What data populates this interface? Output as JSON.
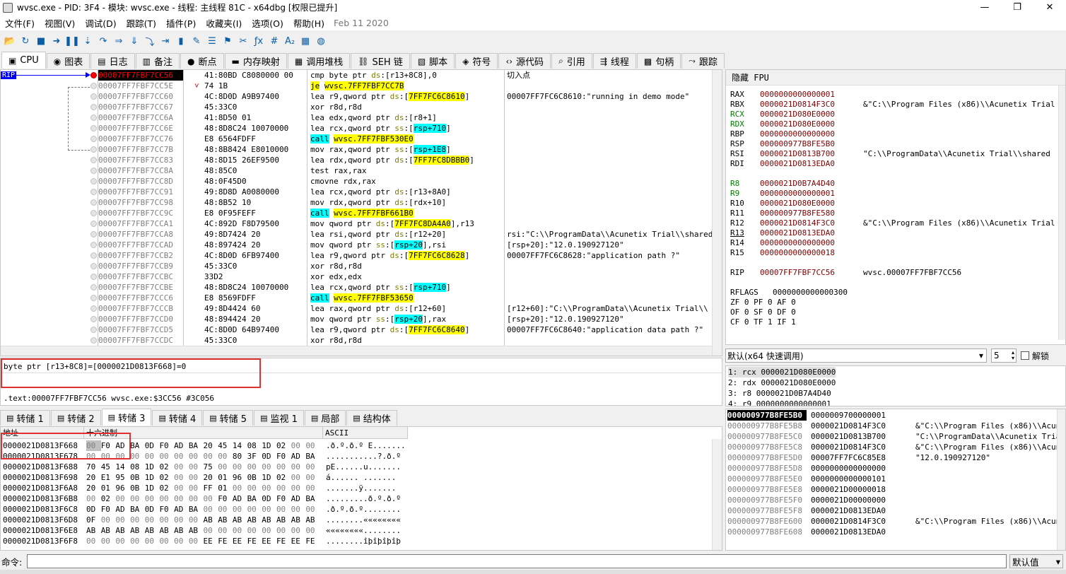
{
  "window": {
    "title": "wvsc.exe - PID: 3F4 - 模块: wvsc.exe - 线程: 主线程 81C - x64dbg [权限已提升]",
    "min_glyph": "—",
    "max_glyph": "❐",
    "close_glyph": "✕"
  },
  "menu": {
    "items": [
      "文件(F)",
      "视图(V)",
      "调试(D)",
      "跟踪(T)",
      "插件(P)",
      "收藏夹(I)",
      "选项(O)",
      "帮助(H)"
    ],
    "date": "Feb 11 2020"
  },
  "toolbar_icons": [
    {
      "name": "open-icon",
      "glyph": "📂"
    },
    {
      "name": "restart-icon",
      "glyph": "↻"
    },
    {
      "name": "stop-icon",
      "glyph": "■"
    },
    {
      "name": "run-icon",
      "glyph": "➜"
    },
    {
      "name": "pause-icon",
      "glyph": "❚❚"
    },
    {
      "name": "step-into-icon",
      "glyph": "⇣"
    },
    {
      "name": "step-over-icon",
      "glyph": "↷"
    },
    {
      "name": "trace-into-icon",
      "glyph": "⇒"
    },
    {
      "name": "trace-over-icon",
      "glyph": "⇓"
    },
    {
      "name": "execute-till-return-icon",
      "glyph": "⤵"
    },
    {
      "name": "run-to-user-code-icon",
      "glyph": "⇥"
    },
    {
      "name": "scylla-icon",
      "glyph": "▮"
    },
    {
      "name": "patch-icon",
      "glyph": "✎"
    },
    {
      "name": "comment-icon",
      "glyph": "☰"
    },
    {
      "name": "label-icon",
      "glyph": "⚑"
    },
    {
      "name": "bookmark-icon",
      "glyph": "✂"
    },
    {
      "name": "function-icon",
      "glyph": "ƒx"
    },
    {
      "name": "hash-icon",
      "glyph": "#"
    },
    {
      "name": "strings-icon",
      "glyph": "A₂"
    },
    {
      "name": "calculator-icon",
      "glyph": "▦"
    },
    {
      "name": "globe-icon",
      "glyph": "◍"
    }
  ],
  "tabs": [
    {
      "label": "CPU",
      "icon": "cpu-icon",
      "glyph": "▣"
    },
    {
      "label": "图表",
      "icon": "graph-icon",
      "glyph": "◉"
    },
    {
      "label": "日志",
      "icon": "log-icon",
      "glyph": "▤"
    },
    {
      "label": "备注",
      "icon": "notes-icon",
      "glyph": "▥"
    },
    {
      "label": "断点",
      "icon": "breakpoint-icon",
      "glyph": "●"
    },
    {
      "label": "内存映射",
      "icon": "memory-map-icon",
      "glyph": "▬"
    },
    {
      "label": "调用堆栈",
      "icon": "call-stack-icon",
      "glyph": "▦"
    },
    {
      "label": "SEH 链",
      "icon": "seh-icon",
      "glyph": "⛓"
    },
    {
      "label": "脚本",
      "icon": "script-icon",
      "glyph": "▧"
    },
    {
      "label": "符号",
      "icon": "symbols-icon",
      "glyph": "◈"
    },
    {
      "label": "源代码",
      "icon": "source-icon",
      "glyph": "‹›"
    },
    {
      "label": "引用",
      "icon": "references-icon",
      "glyph": "⌕"
    },
    {
      "label": "线程",
      "icon": "threads-icon",
      "glyph": "⇶"
    },
    {
      "label": "句柄",
      "icon": "handles-icon",
      "glyph": "▩"
    },
    {
      "label": "跟踪",
      "icon": "trace-icon",
      "glyph": "⤳"
    }
  ],
  "disasm": {
    "rip_label": "RIP",
    "header_comment": "切入点",
    "rows": [
      {
        "addr": "00007FF7FBF7CC56",
        "bytes": "41:80BD C8080000 00",
        "ins": [
          "cmp byte ptr ",
          [
            "ds",
            "seg"
          ],
          ":[r13+8C8],0"
        ],
        "cmt": "",
        "cur": true
      },
      {
        "addr": "00007FF7FBF7CC5E",
        "bytes": "74 1B",
        "ins": [
          [
            "je",
            "je"
          ],
          " ",
          [
            "wvsc.7FF7FBF7CC7B",
            "tgt"
          ]
        ],
        "cmt": "",
        "mark": "˅"
      },
      {
        "addr": "00007FF7FBF7CC60",
        "bytes": "4C:8D0D A9B97400",
        "ins": [
          "lea r9,qword ptr ",
          [
            "ds",
            "seg"
          ],
          ":[",
          [
            "7FF7FC6C8610",
            "mem"
          ],
          "]"
        ],
        "cmt": "00007FF7FC6C8610:\"running in demo mode\""
      },
      {
        "addr": "00007FF7FBF7CC67",
        "bytes": "45:33C0",
        "ins": [
          "xor r8d,r8d"
        ],
        "cmt": ""
      },
      {
        "addr": "00007FF7FBF7CC6A",
        "bytes": "41:8D50 01",
        "ins": [
          "lea edx,qword ptr ",
          [
            "ds",
            "seg"
          ],
          ":[r8+1]"
        ],
        "cmt": ""
      },
      {
        "addr": "00007FF7FBF7CC6E",
        "bytes": "48:8D8C24 10070000",
        "ins": [
          "lea rcx,qword ptr ",
          [
            "ss",
            "seg"
          ],
          ":[",
          [
            "rsp+710",
            "call"
          ],
          "]"
        ],
        "cmt": ""
      },
      {
        "addr": "00007FF7FBF7CC76",
        "bytes": "E8 6564FDFF",
        "ins": [
          [
            "call",
            "call"
          ],
          " ",
          [
            "wvsc.7FF7FBF530E0",
            "tgt"
          ]
        ],
        "cmt": ""
      },
      {
        "addr": "00007FF7FBF7CC7B",
        "bytes": "48:8B8424 E8010000",
        "ins": [
          "mov rax,qword ptr ",
          [
            "ss",
            "seg"
          ],
          ":[",
          [
            "rsp+1E8",
            "call"
          ],
          "]"
        ],
        "cmt": ""
      },
      {
        "addr": "00007FF7FBF7CC83",
        "bytes": "48:8D15 26EF9500",
        "ins": [
          "lea rdx,qword ptr ",
          [
            "ds",
            "seg"
          ],
          ":[",
          [
            "7FF7FC8DBBB0",
            "mem"
          ],
          "]"
        ],
        "cmt": ""
      },
      {
        "addr": "00007FF7FBF7CC8A",
        "bytes": "48:85C0",
        "ins": [
          "test rax,rax"
        ],
        "cmt": ""
      },
      {
        "addr": "00007FF7FBF7CC8D",
        "bytes": "48:0F45D0",
        "ins": [
          "cmovne rdx,rax"
        ],
        "cmt": ""
      },
      {
        "addr": "00007FF7FBF7CC91",
        "bytes": "49:8D8D A0080000",
        "ins": [
          "lea rcx,qword ptr ",
          [
            "ds",
            "seg"
          ],
          ":[r13+8A0]"
        ],
        "cmt": ""
      },
      {
        "addr": "00007FF7FBF7CC98",
        "bytes": "48:8B52 10",
        "ins": [
          "mov rdx,qword ptr ",
          [
            "ds",
            "seg"
          ],
          ":[rdx+10]"
        ],
        "cmt": ""
      },
      {
        "addr": "00007FF7FBF7CC9C",
        "bytes": "E8 0F95FEFF",
        "ins": [
          [
            "call",
            "call"
          ],
          " ",
          [
            "wvsc.7FF7FBF661B0",
            "tgt"
          ]
        ],
        "cmt": ""
      },
      {
        "addr": "00007FF7FBF7CCA1",
        "bytes": "4C:892D F8D79500",
        "ins": [
          "mov qword ptr ",
          [
            "ds",
            "seg"
          ],
          ":[",
          [
            "7FF7FC8DA4A0",
            "mem"
          ],
          "],r13"
        ],
        "cmt": ""
      },
      {
        "addr": "00007FF7FBF7CCA8",
        "bytes": "49:8D7424 20",
        "ins": [
          "lea rsi,qword ptr ",
          [
            "ds",
            "seg"
          ],
          ":[r12+20]"
        ],
        "cmt": "rsi:\"C:\\\\ProgramData\\\\Acunetix Trial\\\\shared\""
      },
      {
        "addr": "00007FF7FBF7CCAD",
        "bytes": "48:897424 20",
        "ins": [
          "mov qword ptr ",
          [
            "ss",
            "seg"
          ],
          ":[",
          [
            "rsp+20",
            "call"
          ],
          "],rsi"
        ],
        "cmt": "[rsp+20]:\"12.0.190927120\""
      },
      {
        "addr": "00007FF7FBF7CCB2",
        "bytes": "4C:8D0D 6FB97400",
        "ins": [
          "lea r9,qword ptr ",
          [
            "ds",
            "seg"
          ],
          ":[",
          [
            "7FF7FC6C8628",
            "mem"
          ],
          "]"
        ],
        "cmt": "00007FF7FC6C8628:\"application path ?\""
      },
      {
        "addr": "00007FF7FBF7CCB9",
        "bytes": "45:33C0",
        "ins": [
          "xor r8d,r8d"
        ],
        "cmt": ""
      },
      {
        "addr": "00007FF7FBF7CCBC",
        "bytes": "33D2",
        "ins": [
          "xor edx,edx"
        ],
        "cmt": ""
      },
      {
        "addr": "00007FF7FBF7CCBE",
        "bytes": "48:8D8C24 10070000",
        "ins": [
          "lea rcx,qword ptr ",
          [
            "ss",
            "seg"
          ],
          ":[",
          [
            "rsp+710",
            "call"
          ],
          "]"
        ],
        "cmt": ""
      },
      {
        "addr": "00007FF7FBF7CCC6",
        "bytes": "E8 8569FDFF",
        "ins": [
          [
            "call",
            "call"
          ],
          " ",
          [
            "wvsc.7FF7FBF53650",
            "tgt"
          ]
        ],
        "cmt": ""
      },
      {
        "addr": "00007FF7FBF7CCCB",
        "bytes": "49:8D4424 60",
        "ins": [
          "lea rax,qword ptr ",
          [
            "ds",
            "seg"
          ],
          ":[r12+60]"
        ],
        "cmt": "[r12+60]:\"C:\\\\ProgramData\\\\Acunetix Trial\\\\"
      },
      {
        "addr": "00007FF7FBF7CCD0",
        "bytes": "48:894424 20",
        "ins": [
          "mov qword ptr ",
          [
            "ss",
            "seg"
          ],
          ":[",
          [
            "rsp+20",
            "call"
          ],
          "],rax"
        ],
        "cmt": "[rsp+20]:\"12.0.190927120\""
      },
      {
        "addr": "00007FF7FBF7CCD5",
        "bytes": "4C:8D0D 64B97400",
        "ins": [
          "lea r9,qword ptr ",
          [
            "ds",
            "seg"
          ],
          ":[",
          [
            "7FF7FC6C8640",
            "mem"
          ],
          "]"
        ],
        "cmt": "00007FF7FC6C8640:\"application data path ?\""
      },
      {
        "addr": "00007FF7FBF7CCDC",
        "bytes": "45:33C0",
        "ins": [
          "xor r8d,r8d"
        ],
        "cmt": ""
      }
    ]
  },
  "info": {
    "line1": "byte ptr [r13+8C8]=[0000021D0813F668]=0",
    "line2": ".text:00007FF7FBF7CC56 wvsc.exe:$3CC56 #3C056"
  },
  "regs": {
    "tabs": [
      "隐藏 FPU"
    ],
    "rows": [
      {
        "n": "RAX",
        "v": "0000000000000001",
        "c": ""
      },
      {
        "n": "RBX",
        "v": "0000021D0814F3C0",
        "c": "&\"C:\\\\Program Files (x86)\\\\Acunetix Trial"
      },
      {
        "n": "RCX",
        "v": "0000021D080E0000",
        "c": "",
        "chg": true
      },
      {
        "n": "RDX",
        "v": "0000021D080E0000",
        "c": "",
        "chg": true
      },
      {
        "n": "RBP",
        "v": "0000000000000000",
        "c": ""
      },
      {
        "n": "RSP",
        "v": "000000977B8FE5B0",
        "c": ""
      },
      {
        "n": "RSI",
        "v": "0000021D0813B700",
        "c": "\"C:\\\\ProgramData\\\\Acunetix Trial\\\\shared"
      },
      {
        "n": "RDI",
        "v": "0000021D0813EDA0",
        "c": ""
      },
      {
        "n": "",
        "v": "",
        "c": ""
      },
      {
        "n": "R8",
        "v": "0000021D0B7A4D40",
        "c": "",
        "chg": true
      },
      {
        "n": "R9",
        "v": "0000000000000001",
        "c": "",
        "chg": true
      },
      {
        "n": "R10",
        "v": "0000021D080E0000",
        "c": ""
      },
      {
        "n": "R11",
        "v": "000000977B8FE580",
        "c": ""
      },
      {
        "n": "R12",
        "v": "0000021D0814F3C0",
        "c": "&\"C:\\\\Program Files (x86)\\\\Acunetix Trial"
      },
      {
        "n": "R13",
        "v": "0000021D0813EDA0",
        "c": "",
        "ul": true
      },
      {
        "n": "R14",
        "v": "0000000000000000",
        "c": ""
      },
      {
        "n": "R15",
        "v": "0000000000000018",
        "c": ""
      },
      {
        "n": "",
        "v": "",
        "c": ""
      },
      {
        "n": "RIP",
        "v": "00007FF7FBF7CC56",
        "c": "wvsc.00007FF7FBF7CC56"
      },
      {
        "n": "",
        "v": "",
        "c": ""
      },
      {
        "n": "RFLAGS",
        "v": "0000000000000300",
        "c": "",
        "plain": true
      }
    ],
    "flags": [
      "ZF 0   PF 0   AF 0",
      "OF 0   SF 0   DF 0",
      "CF 0   TF 1   IF 1"
    ]
  },
  "callconv": {
    "selected": "默认(x64 快速调用)",
    "count": "5",
    "unlock_label": "解锁"
  },
  "args": [
    "1: rcx 0000021D080E0000",
    "2: rdx 0000021D080E0000",
    "3: r8 0000021D0B7A4D40",
    "4: r9 0000000000000001"
  ],
  "dump_tabs": [
    {
      "label": "转储 1",
      "icon": "dump-icon"
    },
    {
      "label": "转储 2",
      "icon": "dump-icon"
    },
    {
      "label": "转储 3",
      "icon": "dump-icon",
      "active": true
    },
    {
      "label": "转储 4",
      "icon": "dump-icon"
    },
    {
      "label": "转储 5",
      "icon": "dump-icon"
    },
    {
      "label": "监视 1",
      "icon": "watch-icon"
    },
    {
      "label": "局部",
      "icon": "locals-icon"
    },
    {
      "label": "结构体",
      "icon": "struct-icon"
    }
  ],
  "dump": {
    "headers": {
      "addr": "地址",
      "hex": "十六进制",
      "ascii": "ASCII"
    },
    "rows": [
      {
        "a": "0000021D0813F668",
        "h": [
          "00",
          "F0",
          "AD",
          "BA",
          "0D",
          "F0",
          "AD",
          "BA",
          "20",
          "45",
          "14",
          "08",
          "1D",
          "02",
          "00",
          "00"
        ],
        "s": ".ð.º.ð.º E......."
      },
      {
        "a": "0000021D0813F678",
        "h": [
          "00",
          "00",
          "00",
          "00",
          "00",
          "00",
          "00",
          "00",
          "00",
          "00",
          "80",
          "3F",
          "0D",
          "F0",
          "AD",
          "BA"
        ],
        "s": "...........?.ð.º"
      },
      {
        "a": "0000021D0813F688",
        "h": [
          "70",
          "45",
          "14",
          "08",
          "1D",
          "02",
          "00",
          "00",
          "75",
          "00",
          "00",
          "00",
          "00",
          "00",
          "00",
          "00"
        ],
        "s": "pE......u......."
      },
      {
        "a": "0000021D0813F698",
        "h": [
          "20",
          "E1",
          "95",
          "0B",
          "1D",
          "02",
          "00",
          "00",
          "20",
          "01",
          "96",
          "0B",
          "1D",
          "02",
          "00",
          "00"
        ],
        "s": " á...... ......."
      },
      {
        "a": "0000021D0813F6A8",
        "h": [
          "20",
          "01",
          "96",
          "0B",
          "1D",
          "02",
          "00",
          "00",
          "FF",
          "01",
          "00",
          "00",
          "00",
          "00",
          "00",
          "00"
        ],
        "s": " .......ÿ......."
      },
      {
        "a": "0000021D0813F6B8",
        "h": [
          "00",
          "02",
          "00",
          "00",
          "00",
          "00",
          "00",
          "00",
          "00",
          "F0",
          "AD",
          "BA",
          "0D",
          "F0",
          "AD",
          "BA"
        ],
        "s": ".........ð.º.ð.º"
      },
      {
        "a": "0000021D0813F6C8",
        "h": [
          "0D",
          "F0",
          "AD",
          "BA",
          "0D",
          "F0",
          "AD",
          "BA",
          "00",
          "00",
          "00",
          "00",
          "00",
          "00",
          "00",
          "00"
        ],
        "s": ".ð.º.ð.º........"
      },
      {
        "a": "0000021D0813F6D8",
        "h": [
          "0F",
          "00",
          "00",
          "00",
          "00",
          "00",
          "00",
          "00",
          "AB",
          "AB",
          "AB",
          "AB",
          "AB",
          "AB",
          "AB",
          "AB"
        ],
        "s": "........««««««««"
      },
      {
        "a": "0000021D0813F6E8",
        "h": [
          "AB",
          "AB",
          "AB",
          "AB",
          "AB",
          "AB",
          "AB",
          "AB",
          "00",
          "00",
          "00",
          "00",
          "00",
          "00",
          "00",
          "00"
        ],
        "s": "««««««««........"
      },
      {
        "a": "0000021D0813F6F8",
        "h": [
          "00",
          "00",
          "00",
          "00",
          "00",
          "00",
          "00",
          "00",
          "EE",
          "FE",
          "EE",
          "FE",
          "EE",
          "FE",
          "EE",
          "FE"
        ],
        "s": "........îþîþîþîþ"
      }
    ]
  },
  "stack": {
    "rows": [
      {
        "a": "000000977B8FE5B0",
        "v": "0000009700000001",
        "c": "",
        "top": true
      },
      {
        "a": "000000977B8FE5B8",
        "v": "0000021D0814F3C0",
        "c": "&\"C:\\\\Program Files (x86)\\\\Acune"
      },
      {
        "a": "000000977B8FE5C0",
        "v": "0000021D0813B700",
        "c": "\"C:\\\\ProgramData\\\\Acunetix Trial"
      },
      {
        "a": "000000977B8FE5C8",
        "v": "0000021D0814F3C0",
        "c": "&\"C:\\\\Program Files (x86)\\\\Acune"
      },
      {
        "a": "000000977B8FE5D0",
        "v": "00007FF7FC6C85E8",
        "c": "\"12.0.190927120\""
      },
      {
        "a": "000000977B8FE5D8",
        "v": "0000000000000000",
        "c": ""
      },
      {
        "a": "000000977B8FE5E0",
        "v": "0000000000000101",
        "c": ""
      },
      {
        "a": "000000977B8FE5E8",
        "v": "0000021D00000018",
        "c": ""
      },
      {
        "a": "000000977B8FE5F0",
        "v": "0000021D00000000",
        "c": ""
      },
      {
        "a": "000000977B8FE5F8",
        "v": "0000021D0813EDA0",
        "c": ""
      },
      {
        "a": "000000977B8FE600",
        "v": "0000021D0814F3C0",
        "c": "&\"C:\\\\Program Files (x86)\\\\Acune"
      },
      {
        "a": "000000977B8FE608",
        "v": "0000021D0813EDA0",
        "c": ""
      }
    ]
  },
  "cmd": {
    "label": "命令:",
    "value": "",
    "default_label": "默认值"
  }
}
